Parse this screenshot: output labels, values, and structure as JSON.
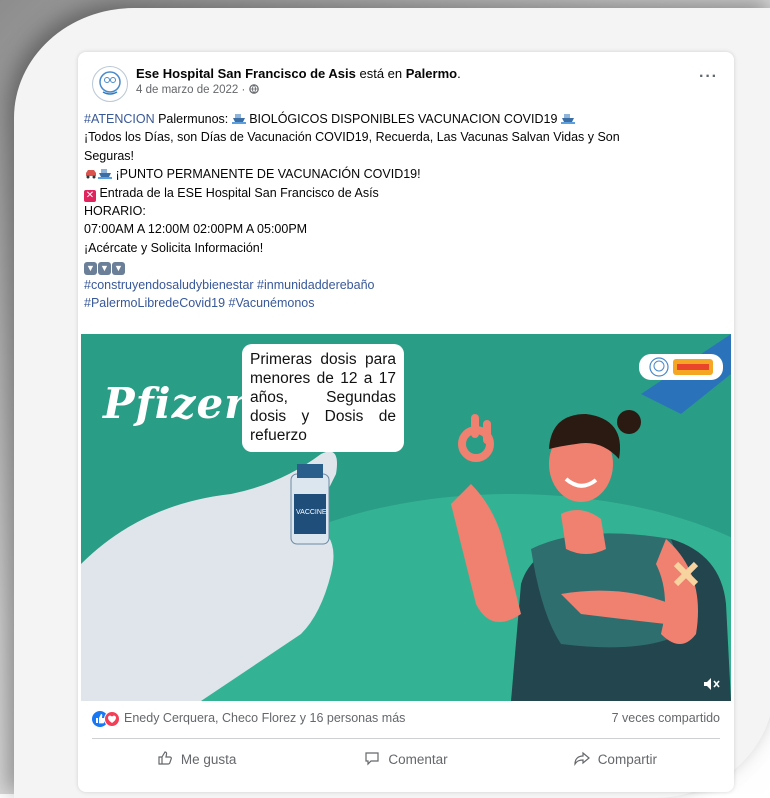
{
  "post": {
    "author": "Ese Hospital San Francisco de Asis",
    "verb": " está en ",
    "place": "Palermo",
    "place_suffix": ".",
    "date": "4 de marzo de 2022 · ",
    "more": "···",
    "lines": {
      "l1_tag": "#ATENCION",
      "l1_text": " Palermunos: ",
      "l1_text2": " BIOLÓGICOS DISPONIBLES VACUNACION COVID19 ",
      "l2": "¡Todos los Días, son Días de Vacunación COVID19, Recuerda, Las Vacunas Salvan Vidas y Son",
      "l3": "Seguras!",
      "l4": " ¡PUNTO PERMANENTE DE VACUNACIÓN COVID19!",
      "l5": " Entrada de la ESE Hospital San Francisco de Asís",
      "l6": "HORARIO:",
      "l7": "07:00AM A 12:00M  02:00PM A 05:00PM",
      "l8": "¡Acércate y Solicita Información!",
      "l10": "#construyendosaludybienestar #inmunidadderebaño",
      "l11": "#PalermoLibredeCovid19 #Vacunémonos"
    }
  },
  "media": {
    "brand": "Pfizer",
    "bubble_text": "Primeras dosis para menores de 12 a 17 años, Segundas dosis y Dosis de refuerzo",
    "vial_label": "VACCINE"
  },
  "engagement": {
    "reactions_text": "Enedy Cerquera, Checo Florez y 16 personas más",
    "shares_text": "7 veces compartido"
  },
  "actions": {
    "like": "Me gusta",
    "comment": "Comentar",
    "share": "Compartir"
  },
  "colors": {
    "link": "#385898",
    "media_bg": "#2a9d86",
    "like_blue": "#1877f2"
  }
}
